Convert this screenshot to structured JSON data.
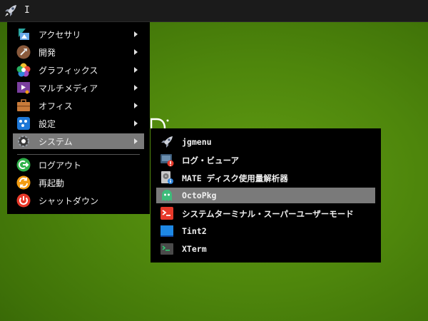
{
  "topbar": {
    "text": "I",
    "launcher_icon": "rocket-icon"
  },
  "main_menu": {
    "items": [
      {
        "label": "アクセサリ",
        "icon": "accessories-icon",
        "submenu": true
      },
      {
        "label": "開発",
        "icon": "development-icon",
        "submenu": true
      },
      {
        "label": "グラフィックス",
        "icon": "graphics-icon",
        "submenu": true
      },
      {
        "label": "マルチメディア",
        "icon": "multimedia-icon",
        "submenu": true
      },
      {
        "label": "オフィス",
        "icon": "office-icon",
        "submenu": true
      },
      {
        "label": "設定",
        "icon": "settings-icon",
        "submenu": true
      },
      {
        "label": "システム",
        "icon": "system-icon",
        "submenu": true,
        "selected": true
      }
    ],
    "actions": [
      {
        "label": "ログアウト",
        "icon": "logout-icon"
      },
      {
        "label": "再起動",
        "icon": "reboot-icon"
      },
      {
        "label": "シャットダウン",
        "icon": "shutdown-icon"
      }
    ]
  },
  "sub_menu": {
    "items": [
      {
        "label": "jgmenu",
        "icon": "rocket-icon"
      },
      {
        "label": "ログ・ビューア",
        "icon": "log-viewer-icon"
      },
      {
        "label": "MATE ディスク使用量解析器",
        "icon": "disk-usage-icon"
      },
      {
        "label": "OctoPkg",
        "icon": "octopkg-icon",
        "selected": true
      },
      {
        "label": "システムターミナル・スーパーユーザーモード",
        "icon": "root-terminal-icon"
      },
      {
        "label": "Tint2",
        "icon": "tint2-icon"
      },
      {
        "label": "XTerm",
        "icon": "xterm-icon"
      }
    ]
  },
  "colors": {
    "menu_bg": "#000000",
    "selection": "#7a7a7a",
    "topbar": "#1b1b1b",
    "desktop": "#4e860c"
  }
}
